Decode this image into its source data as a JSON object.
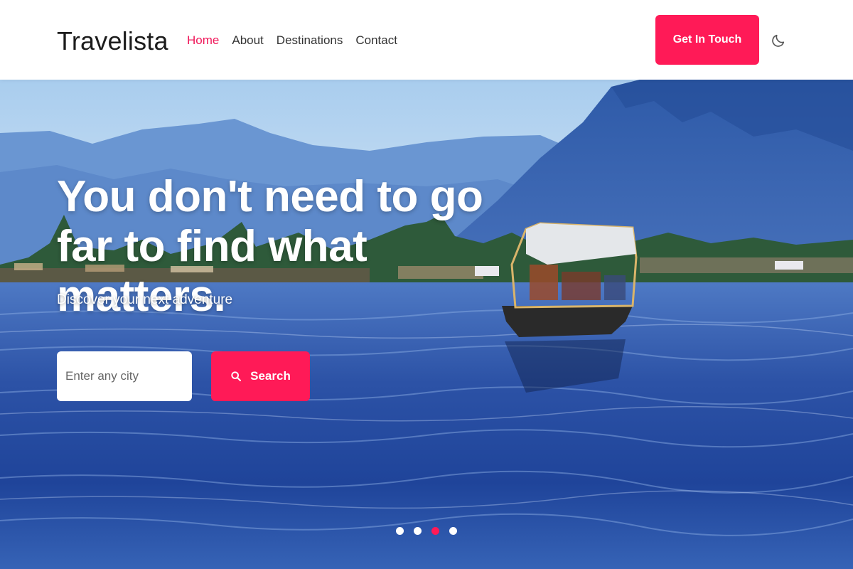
{
  "header": {
    "logo": "Travelista",
    "nav": [
      {
        "label": "Home",
        "active": true
      },
      {
        "label": "About",
        "active": false
      },
      {
        "label": "Destinations",
        "active": false
      },
      {
        "label": "Contact",
        "active": false
      }
    ],
    "cta_label": "Get In Touch",
    "theme_icon": "moon-icon"
  },
  "hero": {
    "title": "You don't need to go far to find what matters.",
    "subtitle": "Discover your next adventure",
    "search": {
      "placeholder": "Enter any city",
      "value": "",
      "button_label": "Search",
      "button_icon": "search-icon"
    },
    "carousel": {
      "slide_count": 4,
      "active_index": 2
    }
  },
  "colors": {
    "accent": "#ff1a57",
    "nav_active": "#f0185a",
    "text_dark": "#1c1c1c"
  }
}
